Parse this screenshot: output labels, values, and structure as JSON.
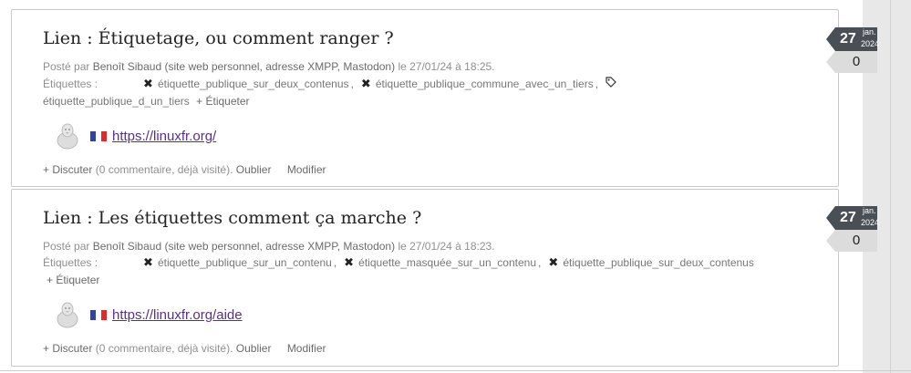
{
  "entries": [
    {
      "title": "Lien : Étiquetage, ou comment ranger ?",
      "meta": {
        "posted_by": "Posté par",
        "author": "Benoît Sibaud",
        "open_paren": "(",
        "website": "site web personnel",
        "comma1": ",",
        "xmpp": "adresse XMPP",
        "comma2": ",",
        "mastodon": "Mastodon",
        "close_paren": ")",
        "datetime": "le 27/01/24 à 18:25."
      },
      "tags_label": "Étiquettes :",
      "tags": [
        "étiquette_publique_sur_deux_contenus",
        "étiquette_publique_commune_avec_un_tiers",
        "étiquette_publique_d_un_tiers"
      ],
      "add_tag": "+ Étiqueter",
      "url": "https://linuxfr.org/",
      "discuss": "+ Discuter",
      "comment_info": "(0 commentaire, déjà visité).",
      "forget": "Oublier",
      "edit": "Modifier",
      "date": {
        "day": "27",
        "month": "jan.",
        "year": "2024"
      },
      "comment_count": "0"
    },
    {
      "title": "Lien : Les étiquettes comment ça marche ?",
      "meta": {
        "posted_by": "Posté par",
        "author": "Benoît Sibaud",
        "open_paren": "(",
        "website": "site web personnel",
        "comma1": ",",
        "xmpp": "adresse XMPP",
        "comma2": ",",
        "mastodon": "Mastodon",
        "close_paren": ")",
        "datetime": "le 27/01/24 à 18:23."
      },
      "tags_label": "Étiquettes :",
      "tags": [
        "étiquette_publique_sur_un_contenu",
        "étiquette_masquée_sur_un_contenu",
        "étiquette_publique_sur_deux_contenus"
      ],
      "add_tag": "+ Étiqueter",
      "url": "https://linuxfr.org/aide",
      "discuss": "+ Discuter",
      "comment_info": "(0 commentaire, déjà visité).",
      "forget": "Oublier",
      "edit": "Modifier",
      "date": {
        "day": "27",
        "month": "jan.",
        "year": "2024"
      },
      "comment_count": "0"
    }
  ],
  "icons": {
    "remove_tag": "close-icon",
    "public_tag": "tag-icon",
    "avatar": "penguin-avatar-icon",
    "flag": "french-flag-icon"
  },
  "colors": {
    "flag_blue": "#3340a8",
    "flag_white": "#ffffff",
    "flag_red": "#e02a2a",
    "date_badge": "#4a4f55",
    "comment_badge": "#dcdcdc",
    "link": "#5a2e8c"
  }
}
